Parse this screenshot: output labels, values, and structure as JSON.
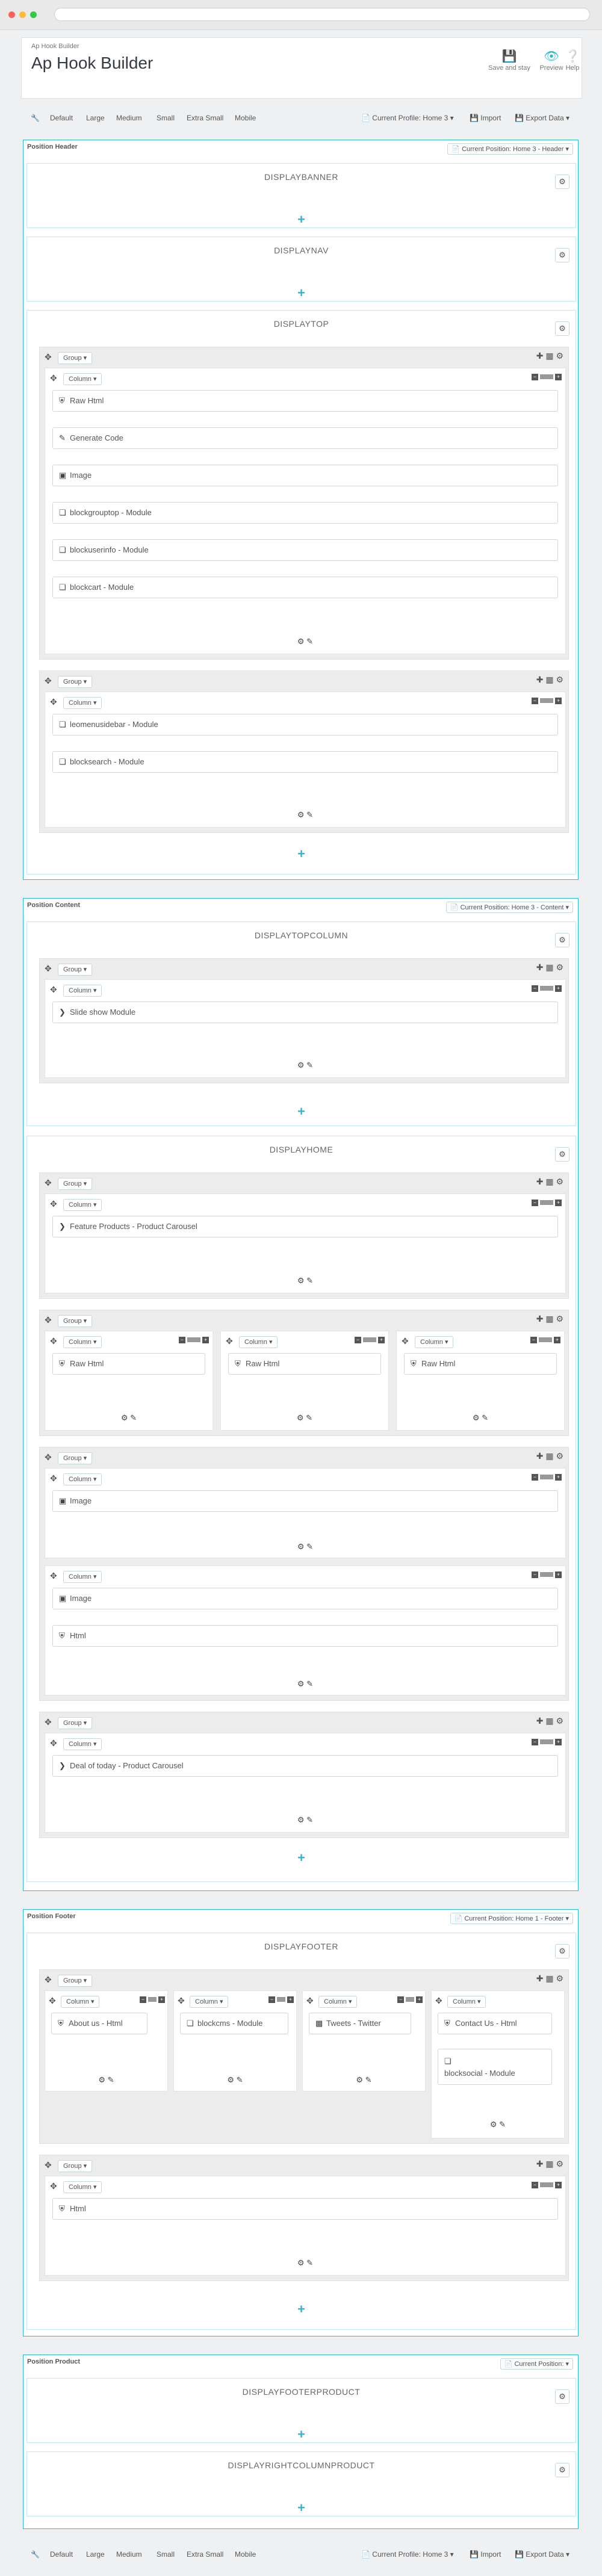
{
  "page": {
    "breadcrumb": "Ap Hook Builder",
    "title": "Ap Hook Builder",
    "actions": [
      {
        "label": "Save and stay",
        "icon": "save-icon"
      },
      {
        "label": "Preview",
        "icon": "eye-icon"
      },
      {
        "label": "Help",
        "icon": "help-icon"
      }
    ]
  },
  "toolbar": {
    "sizes": [
      "Default",
      "Large",
      "Medium",
      "Small",
      "Extra Small",
      "Mobile"
    ],
    "profile_top": "Current Profile: Home 3",
    "profile_bottom": "Current Profile: Home 3",
    "import_label": "Import",
    "export_label": "Export Data"
  },
  "positions": {
    "header": {
      "title": "Position Header",
      "current": "Current Position: Home 3 - Header"
    },
    "content": {
      "title": "Position Content",
      "current": "Current Position: Home 3 - Content"
    },
    "footer": {
      "title": "Position Footer",
      "current": "Current Position: Home 1 - Footer"
    },
    "product": {
      "title": "Position Product",
      "current": "Current Position:"
    }
  },
  "hooks": {
    "displaybanner": "DISPLAYBANNER",
    "displaynav": "DISPLAYNAV",
    "displaytop": "DISPLAYTOP",
    "displaytopcolumn": "DISPLAYTOPCOLUMN",
    "displayhome": "DISPLAYHOME",
    "displayfooter": "DISPLAYFOOTER",
    "displayfooterproduct": "DISPLAYFOOTERPRODUCT",
    "displayrightcolumnproduct": "DISPLAYRIGHTCOLUMNPRODUCT"
  },
  "labels": {
    "group": "Group",
    "column": "Column"
  },
  "widgets": {
    "raw_html": "Raw Html",
    "generate_code": "Generate Code",
    "image": "Image",
    "blockgrouptop": "blockgrouptop - Module",
    "blockuserinfo": "blockuserinfo - Module",
    "blockcart": "blockcart - Module",
    "leomenusidebar": "leomenusidebar - Module",
    "blocksearch": "blocksearch - Module",
    "slideshow": "Slide show Module",
    "feature_products": "Feature Products - Product Carousel",
    "html": "Html",
    "deal_of_today": "Deal of today - Product Carousel",
    "about_us": "About us - Html",
    "blockcms": "blockcms - Module",
    "tweets": "Tweets - Twitter",
    "contact_us": "Contact Us - Html",
    "blocksocial": "blocksocial - Module"
  },
  "colors": {
    "accent": "#25b9d7",
    "title": "#363a41"
  }
}
